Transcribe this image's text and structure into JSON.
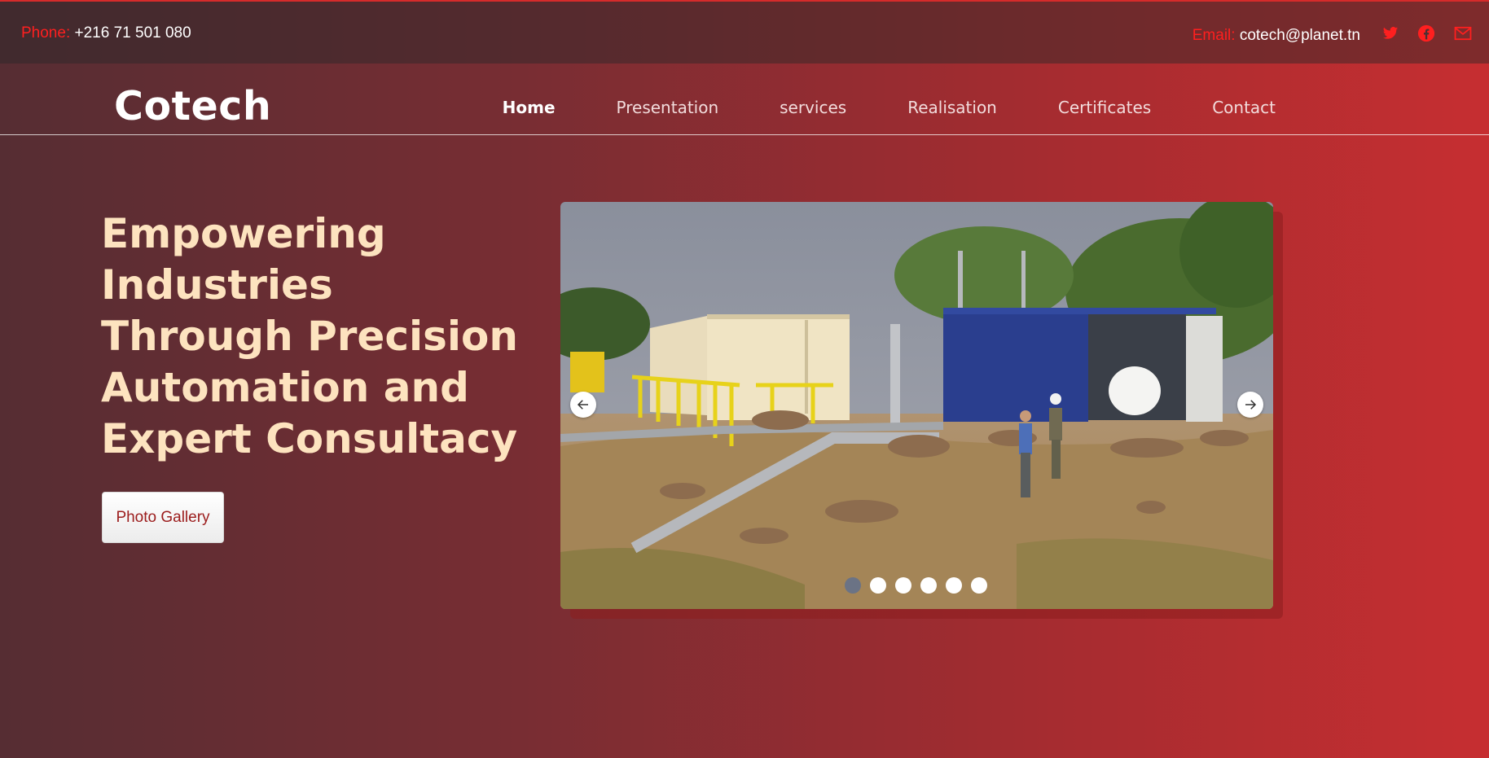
{
  "topbar": {
    "phone_label": "Phone:",
    "phone_value": "+216 71 501 080",
    "email_label": "Email:",
    "email_value": "cotech@planet.tn",
    "social_icons": [
      "twitter-icon",
      "facebook-icon",
      "mail-icon"
    ]
  },
  "navbar": {
    "logo": "Cotech",
    "items": [
      {
        "label": "Home",
        "active": true
      },
      {
        "label": "Presentation"
      },
      {
        "label": "services"
      },
      {
        "label": "Realisation"
      },
      {
        "label": "Certificates"
      },
      {
        "label": "Contact"
      }
    ]
  },
  "hero": {
    "title": "Empowering Industries Through Precision Automation and Expert Consultacy",
    "button_label": "Photo Gallery"
  },
  "slider": {
    "slide_count": 6,
    "active_slide": 1,
    "icons": [
      "arrow-left-icon",
      "arrow-right-icon"
    ]
  },
  "colors": {
    "accent_red": "#ff1f1f",
    "hero_text": "#fde3bf",
    "button_text": "#9b1c1c",
    "active_dot": "#6b7385"
  }
}
